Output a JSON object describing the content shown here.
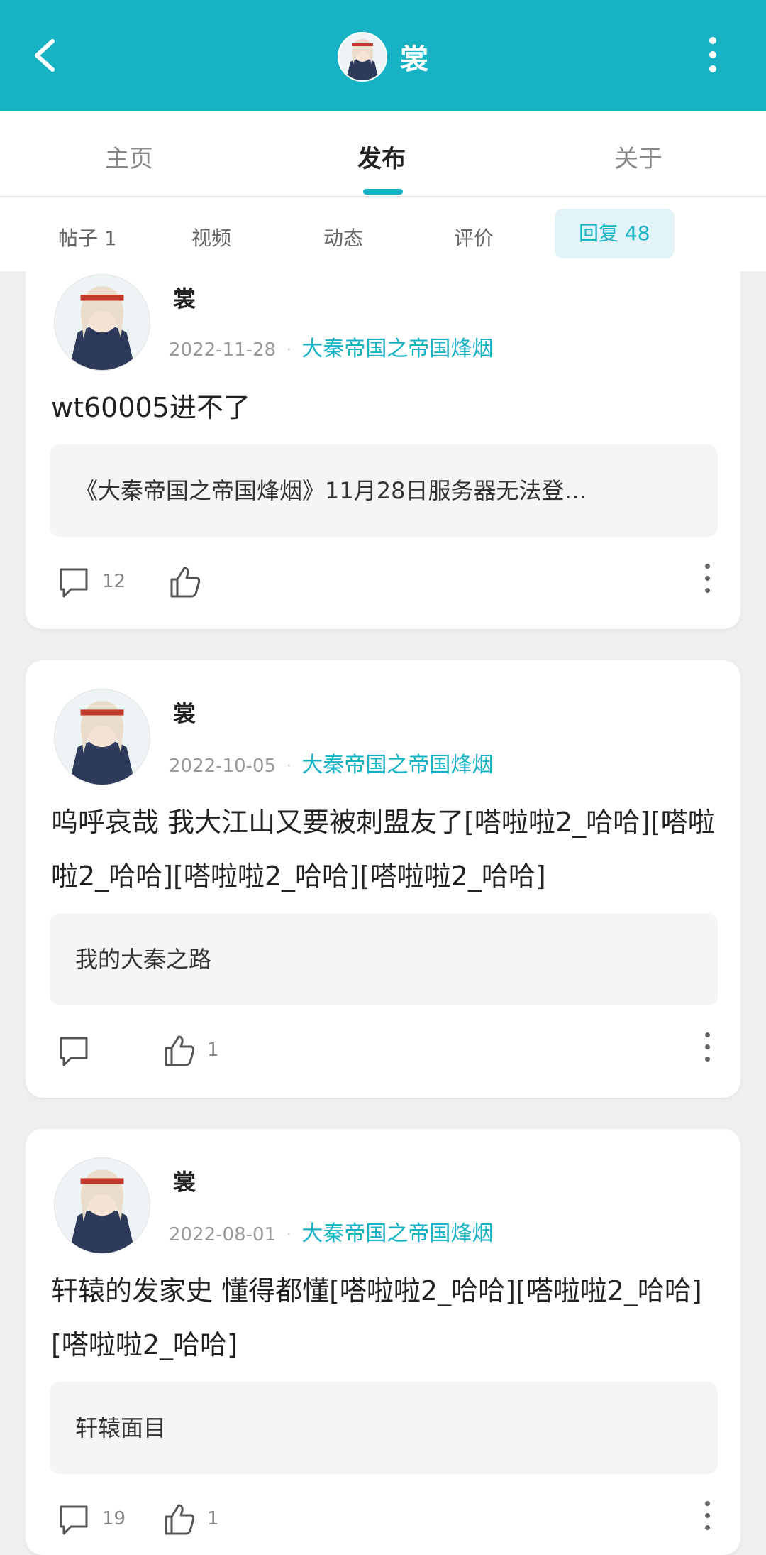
{
  "header": {
    "back_icon": "back-arrow-icon",
    "username": "裳",
    "more_icon": "more-vertical-icon",
    "accent_color": "#17b3c4"
  },
  "main_tabs": [
    {
      "label": "主页"
    },
    {
      "label": "发布"
    },
    {
      "label": "关于"
    }
  ],
  "sub_tabs": [
    {
      "label": "帖子 1"
    },
    {
      "label": "视频"
    },
    {
      "label": "动态"
    },
    {
      "label": "评价"
    },
    {
      "label": "回复 48"
    }
  ],
  "posts": [
    {
      "author": "裳",
      "date": "2022-11-28",
      "game": "大秦帝国之帝国烽烟",
      "content": "wt60005进不了",
      "quote": "《大秦帝国之帝国烽烟》11月28日服务器无法登…",
      "comments": "12",
      "likes": ""
    },
    {
      "author": "裳",
      "date": "2022-10-05",
      "game": "大秦帝国之帝国烽烟",
      "content": "呜呼哀哉 我大江山又要被刺盟友了[嗒啦啦2_哈哈][嗒啦啦2_哈哈][嗒啦啦2_哈哈][嗒啦啦2_哈哈]",
      "quote": "我的大秦之路",
      "comments": "",
      "likes": "1"
    },
    {
      "author": "裳",
      "date": "2022-08-01",
      "game": "大秦帝国之帝国烽烟",
      "content": "轩辕的发家史 懂得都懂[嗒啦啦2_哈哈][嗒啦啦2_哈哈][嗒啦啦2_哈哈]",
      "quote": "轩辕面目",
      "comments": "19",
      "likes": "1"
    }
  ]
}
